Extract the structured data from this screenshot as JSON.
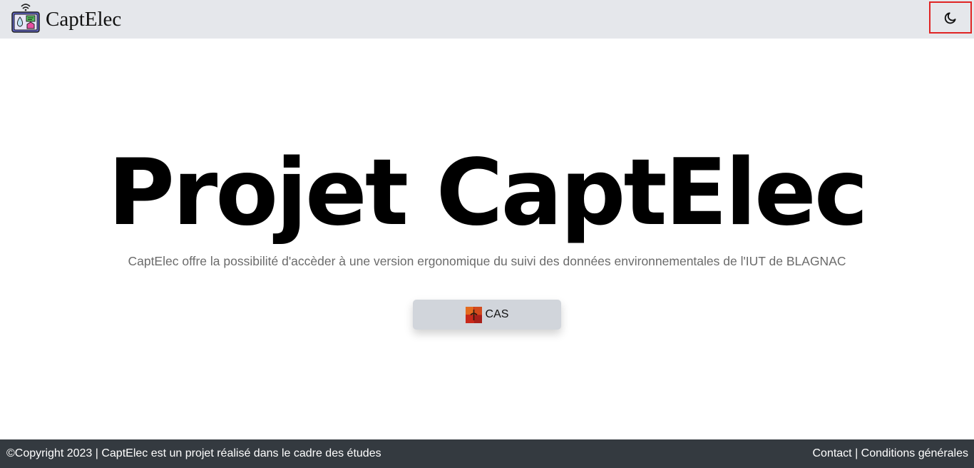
{
  "navbar": {
    "brand_name": "CaptElec",
    "theme_toggle_icon": "moon-icon",
    "brand_logo_icon": "captelec-logo-icon"
  },
  "hero": {
    "title": "Projet CaptElec",
    "subtitle": "CaptElec offre la possibilité d'accèder à une version ergonomique du suivi des données environnementales de l'IUT de BLAGNAC",
    "cas_button_label": "CAS",
    "cas_icon": "cas-logo-icon"
  },
  "footer": {
    "copyright": "©Copyright 2023 | CaptElec est un projet réalisé dans le cadre des études",
    "contact_label": "Contact",
    "separator": " | ",
    "conditions_label": "Conditions générales",
    "background_color": "#343a40"
  },
  "colors": {
    "navbar_bg": "#e5e7eb",
    "highlight_border": "#e02424",
    "button_bg": "#d1d5db"
  }
}
